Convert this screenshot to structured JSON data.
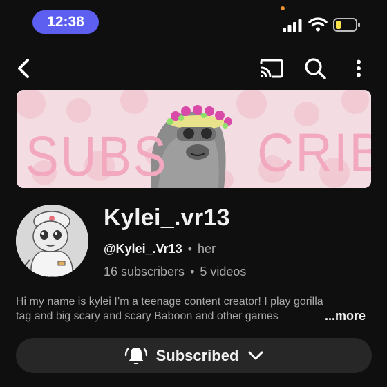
{
  "status_bar": {
    "time": "12:38",
    "accent_color": "#5c5ff0"
  },
  "app_bar": {
    "icons": [
      "back-arrow-icon",
      "cast-icon",
      "search-icon",
      "more-vert-icon"
    ]
  },
  "banner": {
    "text_left": "SUBS",
    "text_right": "CRIBE",
    "text_color": "#f2a9bf"
  },
  "channel": {
    "name": "Kylei_.vr13",
    "handle": "@Kylei_.Vr13",
    "separator": "•",
    "pronoun": "her",
    "subscribers": "16 subscribers",
    "videos": "5 videos"
  },
  "description": {
    "line1": "Hi my name is kylei I’m a teenage content creator! I play gorilla",
    "line2": "tag and big scary and scary Baboon and other games",
    "more": "...more"
  },
  "subscribe_button": {
    "label": "Subscribed",
    "icon": "bell-icon"
  }
}
